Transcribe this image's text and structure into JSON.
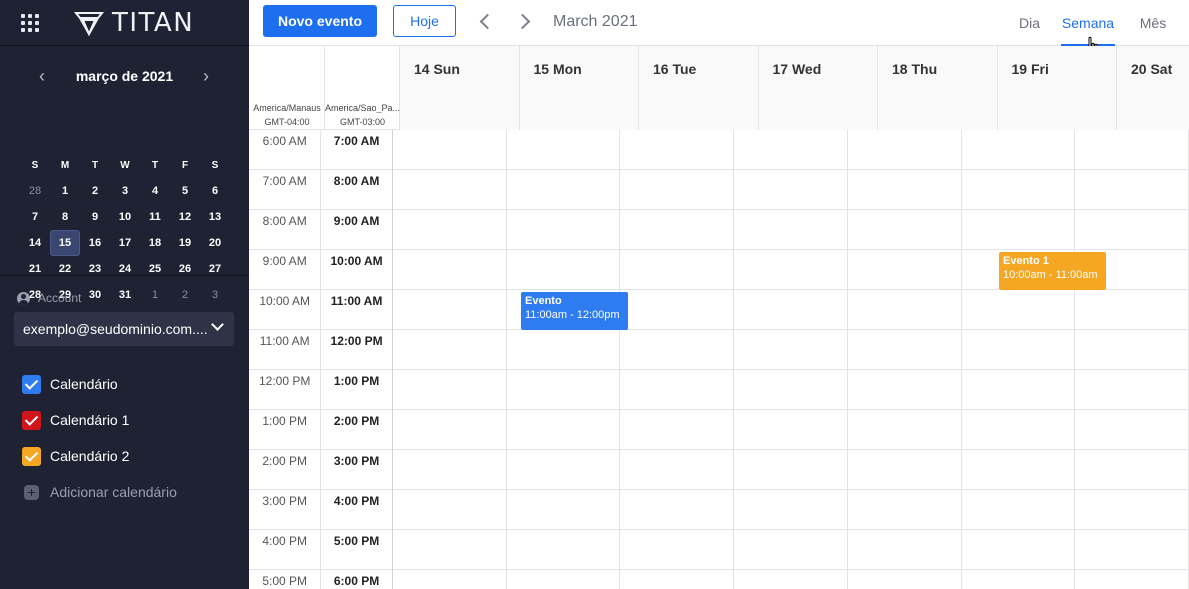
{
  "app": {
    "name": "TITAN"
  },
  "mini_calendar": {
    "title": "março de 2021",
    "weekdays": [
      "S",
      "M",
      "T",
      "W",
      "T",
      "F",
      "S"
    ],
    "weeks": [
      [
        {
          "d": "28",
          "m": true
        },
        {
          "d": "1"
        },
        {
          "d": "2"
        },
        {
          "d": "3"
        },
        {
          "d": "4"
        },
        {
          "d": "5"
        },
        {
          "d": "6"
        }
      ],
      [
        {
          "d": "7"
        },
        {
          "d": "8"
        },
        {
          "d": "9"
        },
        {
          "d": "10"
        },
        {
          "d": "11"
        },
        {
          "d": "12"
        },
        {
          "d": "13"
        }
      ],
      [
        {
          "d": "14"
        },
        {
          "d": "15",
          "sel": true
        },
        {
          "d": "16"
        },
        {
          "d": "17"
        },
        {
          "d": "18"
        },
        {
          "d": "19"
        },
        {
          "d": "20"
        }
      ],
      [
        {
          "d": "21"
        },
        {
          "d": "22"
        },
        {
          "d": "23"
        },
        {
          "d": "24"
        },
        {
          "d": "25"
        },
        {
          "d": "26"
        },
        {
          "d": "27"
        }
      ],
      [
        {
          "d": "28"
        },
        {
          "d": "29"
        },
        {
          "d": "30"
        },
        {
          "d": "31"
        },
        {
          "d": "1",
          "m": true
        },
        {
          "d": "2",
          "m": true
        },
        {
          "d": "3",
          "m": true
        }
      ]
    ]
  },
  "account": {
    "label": "Account",
    "selected": "exemplo@seudominio.com...."
  },
  "calendars": [
    {
      "label": "Calendário",
      "color": "#2f7bf0"
    },
    {
      "label": "Calendário 1",
      "color": "#d0161b"
    },
    {
      "label": "Calendário 2",
      "color": "#f5a623"
    }
  ],
  "add_calendar_label": "Adicionar calendário",
  "toolbar": {
    "new_event_label": "Novo evento",
    "today_label": "Hoje",
    "period_title": "March 2021",
    "views": {
      "day": "Dia",
      "week": "Semana",
      "month": "Mês"
    },
    "active_view": "week"
  },
  "timezones": [
    {
      "name": "America/Manaus",
      "offset": "GMT-04:00"
    },
    {
      "name": "America/Sao_Pa...",
      "offset": "GMT-03:00"
    }
  ],
  "days": [
    "14 Sun",
    "15 Mon",
    "16 Tue",
    "17 Wed",
    "18 Thu",
    "19 Fri",
    "20 Sat"
  ],
  "time_rows": [
    {
      "a": "6:00 AM",
      "b": "7:00 AM"
    },
    {
      "a": "7:00 AM",
      "b": "8:00 AM"
    },
    {
      "a": "8:00 AM",
      "b": "9:00 AM"
    },
    {
      "a": "9:00 AM",
      "b": "10:00 AM"
    },
    {
      "a": "10:00 AM",
      "b": "11:00 AM"
    },
    {
      "a": "11:00 AM",
      "b": "12:00 PM"
    },
    {
      "a": "12:00 PM",
      "b": "1:00 PM"
    },
    {
      "a": "1:00 PM",
      "b": "2:00 PM"
    },
    {
      "a": "2:00 PM",
      "b": "3:00 PM"
    },
    {
      "a": "3:00 PM",
      "b": "4:00 PM"
    },
    {
      "a": "4:00 PM",
      "b": "5:00 PM"
    },
    {
      "a": "5:00 PM",
      "b": "6:00 PM"
    }
  ],
  "events": [
    {
      "title": "Evento",
      "time": "11:00am - 12:00pm",
      "color": "#2f7bf0"
    },
    {
      "title": "Evento 1",
      "time": "10:00am - 11:00am",
      "color": "#f5a623"
    }
  ]
}
